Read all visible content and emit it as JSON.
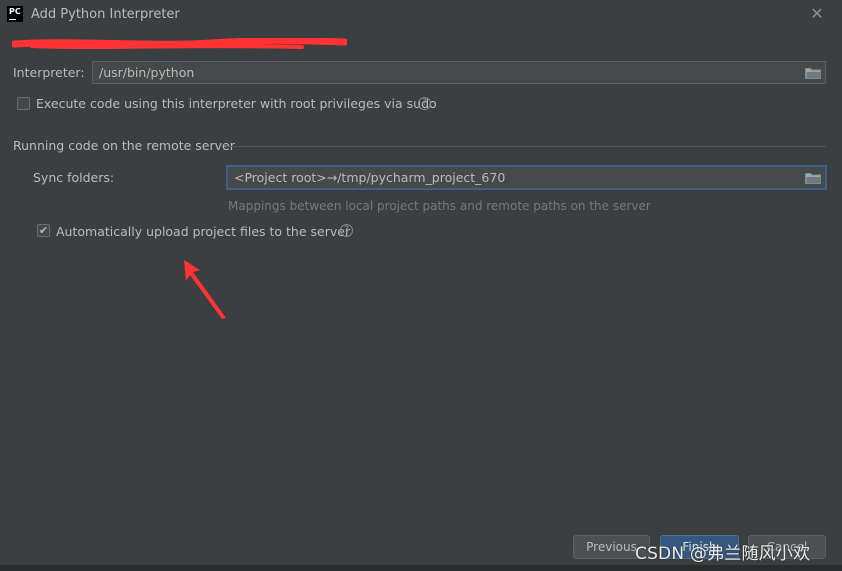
{
  "window": {
    "title": "Add Python Interpreter",
    "app_logo_text": "PC"
  },
  "interpreter": {
    "label": "Interpreter:",
    "value": "/usr/bin/python"
  },
  "sudo": {
    "label": "Execute code using this interpreter with root privileges via sudo",
    "checked": false
  },
  "remote": {
    "section_title": "Running code on the remote server",
    "sync_label": "Sync folders:",
    "sync_value": "<Project root>→/tmp/pycharm_project_670",
    "sync_hint": "Mappings between local project paths and remote paths on the server",
    "upload_label": "Automatically upload project files to the server",
    "upload_checked": true
  },
  "footer": {
    "previous_label": "Previous",
    "finish_label": "Finish",
    "cancel_label": "Cancel",
    "watermark": "CSDN @弗兰随风小欢"
  },
  "colors": {
    "background": "#3c3f41",
    "field": "#45494a",
    "focus_border": "#3d6185",
    "primary_button": "#365880",
    "annotation_red": "#ff3333"
  },
  "icons": {
    "close": "close-icon",
    "folder": "folder-icon",
    "help": "help-icon",
    "check": "check-icon"
  }
}
